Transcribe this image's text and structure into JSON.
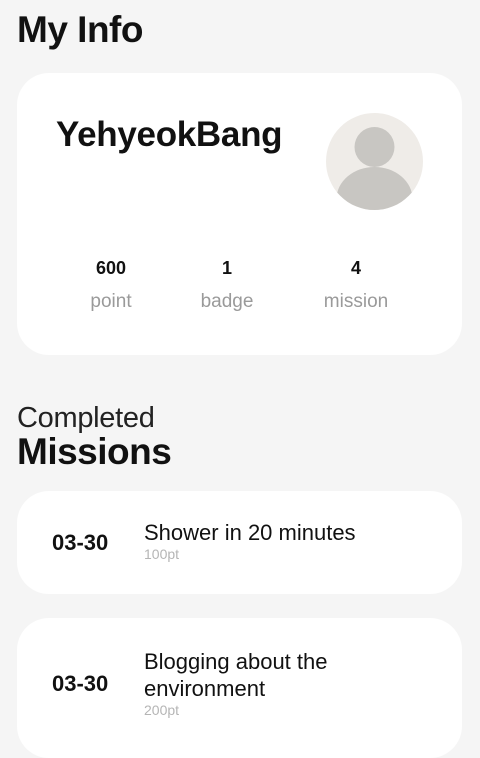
{
  "header": {
    "title": "My Info"
  },
  "profile": {
    "username": "YehyeokBang",
    "avatar_icon": "user-avatar-icon",
    "stats": [
      {
        "value": "600",
        "label": "point"
      },
      {
        "value": "1",
        "label": "badge"
      },
      {
        "value": "4",
        "label": "mission"
      }
    ]
  },
  "completed": {
    "title_light": "Completed",
    "title_bold": "Missions",
    "missions": [
      {
        "date": "03-30",
        "name": "Shower in 20 minutes",
        "points": "100pt"
      },
      {
        "date": "03-30",
        "name": "Blogging about the environment",
        "points": "200pt"
      }
    ]
  },
  "colors": {
    "background": "#f5f5f5",
    "card": "#ffffff",
    "avatar_bg": "#efece8",
    "avatar_figure": "#c8c6c2",
    "muted_text": "#9a9a9a"
  }
}
